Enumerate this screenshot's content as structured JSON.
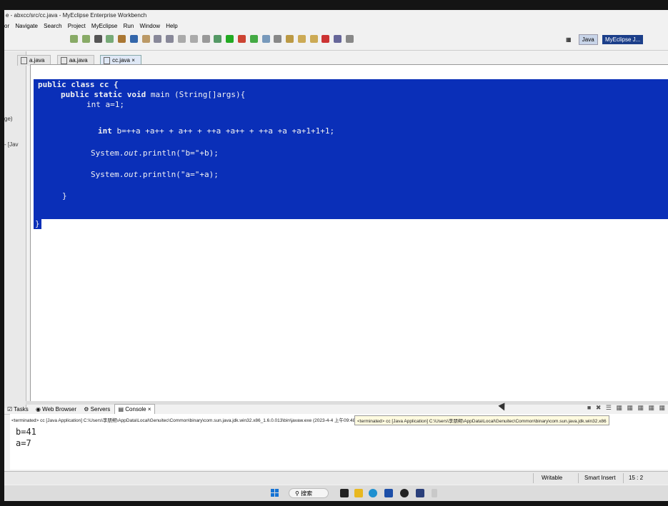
{
  "window": {
    "title": "e - abxcc/src/cc.java - MyEclipse Enterprise Workbench"
  },
  "menu": {
    "items": [
      "or",
      "Navigate",
      "Search",
      "Project",
      "MyEclipse",
      "Run",
      "Window",
      "Help"
    ]
  },
  "perspectives": {
    "java": "Java",
    "myeclipse": "MyEclipse J..."
  },
  "left_trim": {
    "label1": "ge)",
    "label2": "- [Jav"
  },
  "tabs": [
    {
      "label": "a.java"
    },
    {
      "label": "aa.java"
    },
    {
      "label": "cc.java"
    }
  ],
  "code": {
    "line1": "public class cc {",
    "line2_pre": "public static void ",
    "line2_post": "main (String[]args){",
    "line3": "int a=1;",
    "line4_kw": "int",
    "line4_rest": " b=++a +a++ + a++ + ++a +a++ + ++a +a +a+1+1+1;",
    "line5_a": "System.",
    "line5_b": "out",
    "line5_c": ".println(\"b=\"+b);",
    "line6_a": "System.",
    "line6_b": "out",
    "line6_c": ".println(\"a=\"+a);",
    "line7": "}",
    "line8": "}"
  },
  "console_tabs": {
    "tasks": "Tasks",
    "browser": "Web Browser",
    "servers": "Servers",
    "console": "Console"
  },
  "console": {
    "terminated": "<terminated> cc [Java Application] C:\\Users\\李朋朔\\AppData\\Local\\Genuitec\\Common\\binary\\com.sun.java.jdk.win32.x86_1.6.0.013\\bin\\javaw.exe (2023-4-4 上午09:48:39)",
    "tooltip": "<terminated> cc [Java Application] C:\\Users\\李朋朔\\AppData\\Local\\Genuitec\\Common\\binary\\com.sun.java.jdk.win32.x86",
    "out1": "b=41",
    "out2": "a=7"
  },
  "status": {
    "writable": "Writable",
    "insert": "Smart Insert",
    "position": "15 : 2"
  },
  "taskbar": {
    "search": "搜索"
  },
  "colors": {
    "selection": "#0a2fb8"
  }
}
